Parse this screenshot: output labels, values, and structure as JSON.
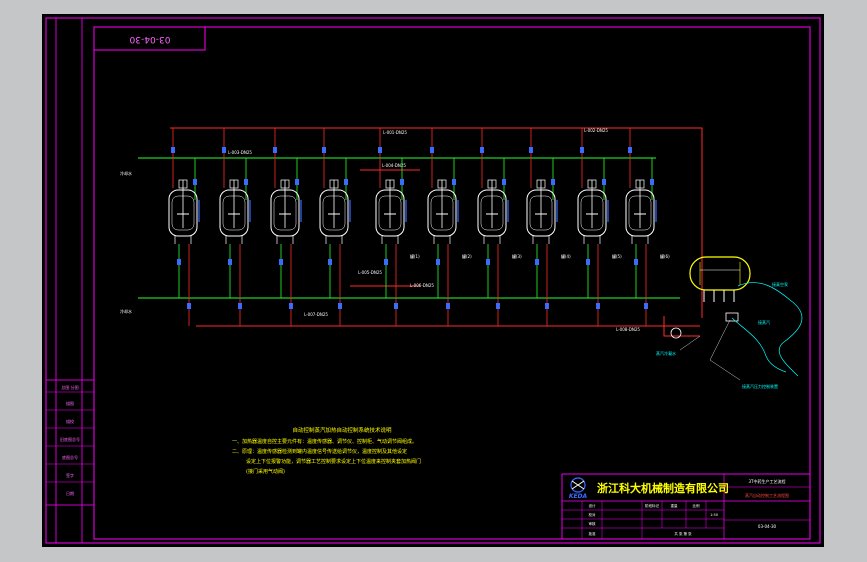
{
  "drawing_number_stamp": "03-04-30",
  "tanks": [
    {
      "label": ""
    },
    {
      "label": ""
    },
    {
      "label": ""
    },
    {
      "label": ""
    },
    {
      "label": "罐(1)"
    },
    {
      "label": "罐(2)"
    },
    {
      "label": "罐(3)"
    },
    {
      "label": "罐(4)"
    },
    {
      "label": "罐(5)"
    },
    {
      "label": "罐(6)"
    }
  ],
  "pipe_labels": {
    "top1": "L-001-DN25",
    "top2": "L-002-DN25",
    "mid1": "L-003-DN25",
    "mid2": "L-004-DN25",
    "low1": "L-005-DN25",
    "low2": "L-006-DN25",
    "bottom1": "L-007-DN25",
    "bottom2": "L-008-DN25",
    "left_upper": "冷却水",
    "left_lower": "冷却水",
    "pump": "蒸汽冷凝水"
  },
  "annotations": {
    "recv1": "接真空泵",
    "recv2": "接蒸汽",
    "recv3": "接蒸汽压力控制装置"
  },
  "notes": {
    "title": "自动控制蒸汽加热自动控制系统技术说明",
    "line1": "一、加热器温度自控主要元件有：温度传感器、调节仪、控制柜、气动调节阀组成。",
    "line2": "二、原理：温度传感器检测到罐内温度信号传送给调节仪，温度控制及其他设定",
    "line3": "设定上下位报警功能，调节器工艺控制要求设定上下位温度来控制夹套加热阀门",
    "line4": "(接门采用气动阀)"
  },
  "title_block": {
    "company": "浙江科大机械制造有限公司",
    "logo_text": "KEDA",
    "project": "3T中药生产工艺流程",
    "drawing_name": "蒸汽自动控制工艺流程图",
    "scale": "1:50",
    "drawing_number": "03-04-30",
    "cell_a": "设计",
    "cell_b": "校对",
    "cell_c": "审核",
    "cell_d": "批准",
    "cell_e": "阶段标记",
    "cell_f": "重量",
    "cell_g": "比例",
    "cell_h": "共 张 第 张"
  },
  "side_table": {
    "row1": "总图 分图",
    "row2": "描图",
    "row3": "描校",
    "row4": "旧底图总号",
    "row5": "底图总号",
    "row6": "签字",
    "row7": "日期"
  },
  "colors": {
    "frame": "#ff00ff",
    "red_pipe": "#ff2a2a",
    "green_pipe": "#2aff2a",
    "blue_valve": "#3a6bff",
    "yellow": "#ffff00",
    "cyan": "#00ffff",
    "white": "#ffffff"
  }
}
